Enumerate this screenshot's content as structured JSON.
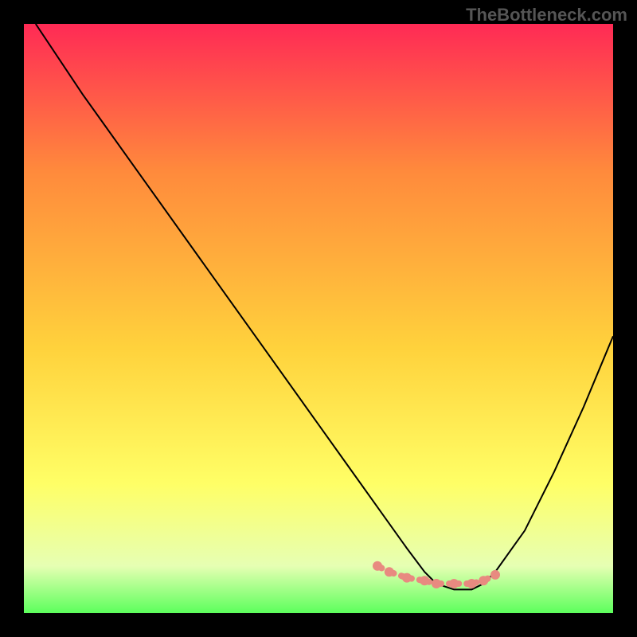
{
  "watermark": "TheBottleneck.com",
  "chart_data": {
    "type": "line",
    "title": "",
    "xlabel": "",
    "ylabel": "",
    "xlim": [
      0,
      100
    ],
    "ylim": [
      0,
      100
    ],
    "grid": false,
    "legend": false,
    "background_gradient": {
      "top": "#ff2a55",
      "mid1": "#ff6a3c",
      "mid2": "#ffd23c",
      "mid3": "#ffff66",
      "mid4": "#e6ffb3",
      "bottom": "#5cff5c"
    },
    "series": [
      {
        "name": "bottleneck-curve",
        "x": [
          2,
          10,
          20,
          30,
          40,
          50,
          55,
          60,
          65,
          68,
          70,
          73,
          76,
          78,
          80,
          85,
          90,
          95,
          100
        ],
        "y": [
          100,
          88,
          74,
          60,
          46,
          32,
          25,
          18,
          11,
          7,
          5,
          4,
          4,
          5,
          7,
          14,
          24,
          35,
          47
        ],
        "color": "#000000",
        "width": 2
      }
    ],
    "highlight_zone": {
      "name": "optimal-range",
      "x": [
        60,
        62,
        65,
        68,
        70,
        73,
        76,
        78,
        80
      ],
      "y": [
        8,
        7,
        6,
        5.5,
        5,
        5,
        5,
        5.5,
        6.5
      ],
      "color": "#e88a80",
      "marker_size": 8
    }
  }
}
